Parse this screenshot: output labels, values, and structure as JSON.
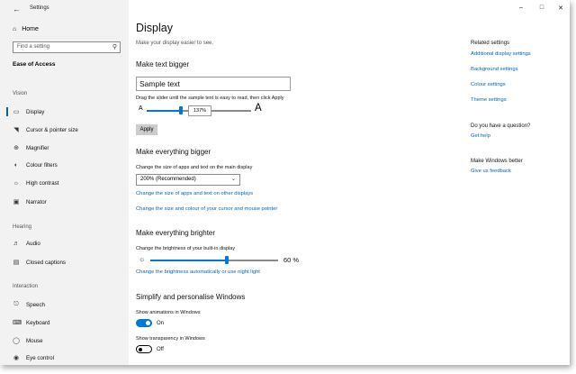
{
  "window": {
    "title": "Settings",
    "back_icon": "back-arrow-icon",
    "controls": [
      "minimize-icon",
      "maximize-icon",
      "close-icon"
    ]
  },
  "sidebar": {
    "home": "Home",
    "search_placeholder": "Find a setting",
    "section": "Ease of Access",
    "groups": [
      {
        "label": "Vision",
        "items": [
          {
            "label": "Display",
            "icon": "display-icon",
            "active": true
          },
          {
            "label": "Cursor & pointer size",
            "icon": "cursor-icon"
          },
          {
            "label": "Magnifier",
            "icon": "magnifier-icon"
          },
          {
            "label": "Colour filters",
            "icon": "colour-filters-icon"
          },
          {
            "label": "High contrast",
            "icon": "high-contrast-icon"
          },
          {
            "label": "Narrator",
            "icon": "narrator-icon"
          }
        ]
      },
      {
        "label": "Hearing",
        "items": [
          {
            "label": "Audio",
            "icon": "audio-icon"
          },
          {
            "label": "Closed captions",
            "icon": "closed-captions-icon"
          }
        ]
      },
      {
        "label": "Interaction",
        "items": [
          {
            "label": "Speech",
            "icon": "speech-icon"
          },
          {
            "label": "Keyboard",
            "icon": "keyboard-icon"
          },
          {
            "label": "Mouse",
            "icon": "mouse-icon"
          },
          {
            "label": "Eye control",
            "icon": "eye-control-icon"
          }
        ]
      }
    ]
  },
  "main": {
    "title": "Display",
    "subtitle": "Make your display easier to see.",
    "text_bigger": {
      "heading": "Make text bigger",
      "sample": "Sample text",
      "instruction": "Drag the slider until the sample text is easy to read, then click Apply",
      "small_a": "A",
      "large_a": "A",
      "value": "137%",
      "apply": "Apply"
    },
    "everything_bigger": {
      "heading": "Make everything bigger",
      "label": "Change the size of apps and text on the main display",
      "selected": "200% (Recommended)",
      "link1": "Change the size of apps and text on other displays",
      "link2": "Change the size and colour of your cursor and mouse pointer"
    },
    "brighter": {
      "heading": "Make everything brighter",
      "label": "Change the brightness of your built-in display",
      "value": "60 %",
      "level": 0.6,
      "link": "Change the brightness automatically or use night light"
    },
    "simplify": {
      "heading": "Simplify and personalise Windows",
      "animations_label": "Show animations in Windows",
      "animations_state": "On",
      "transparency_label": "Show transparency in Windows",
      "transparency_state": "Off"
    }
  },
  "related": {
    "heading": "Related settings",
    "links": [
      "Additional display settings",
      "Background settings",
      "Colour settings",
      "Theme settings"
    ],
    "question": "Do you have a question?",
    "help": "Get help",
    "better": "Make Windows better",
    "feedback": "Give us feedback"
  },
  "colors": {
    "accent": "#0078d7",
    "link": "#0067b8",
    "sidebar_bg": "#f2f2f2"
  }
}
